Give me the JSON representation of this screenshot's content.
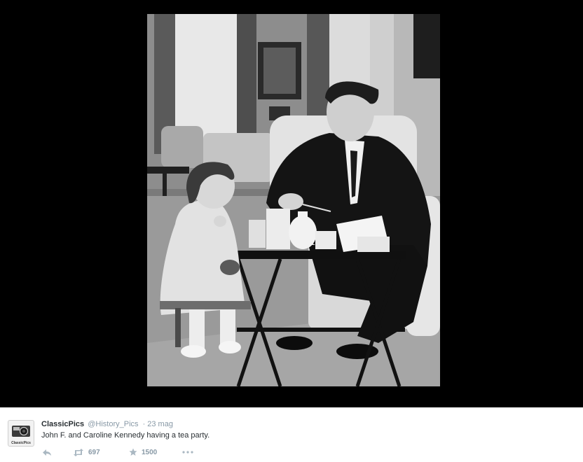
{
  "tweet": {
    "display_name": "ClassicPics",
    "handle": "@History_Pics",
    "separator": "·",
    "timestamp": "23 mag",
    "text": "John F. and Caroline Kennedy having a tea party.",
    "retweet_count": "697",
    "favorite_count": "1500",
    "avatar_label": "ClassicPics"
  },
  "icons": {
    "reply": "reply-icon",
    "retweet": "retweet-icon",
    "favorite": "star-icon",
    "more": "more-icon"
  },
  "colors": {
    "viewer_background": "#000000",
    "text_primary": "#292f33",
    "text_secondary": "#8899a6",
    "icon_muted": "#aab8c2"
  }
}
